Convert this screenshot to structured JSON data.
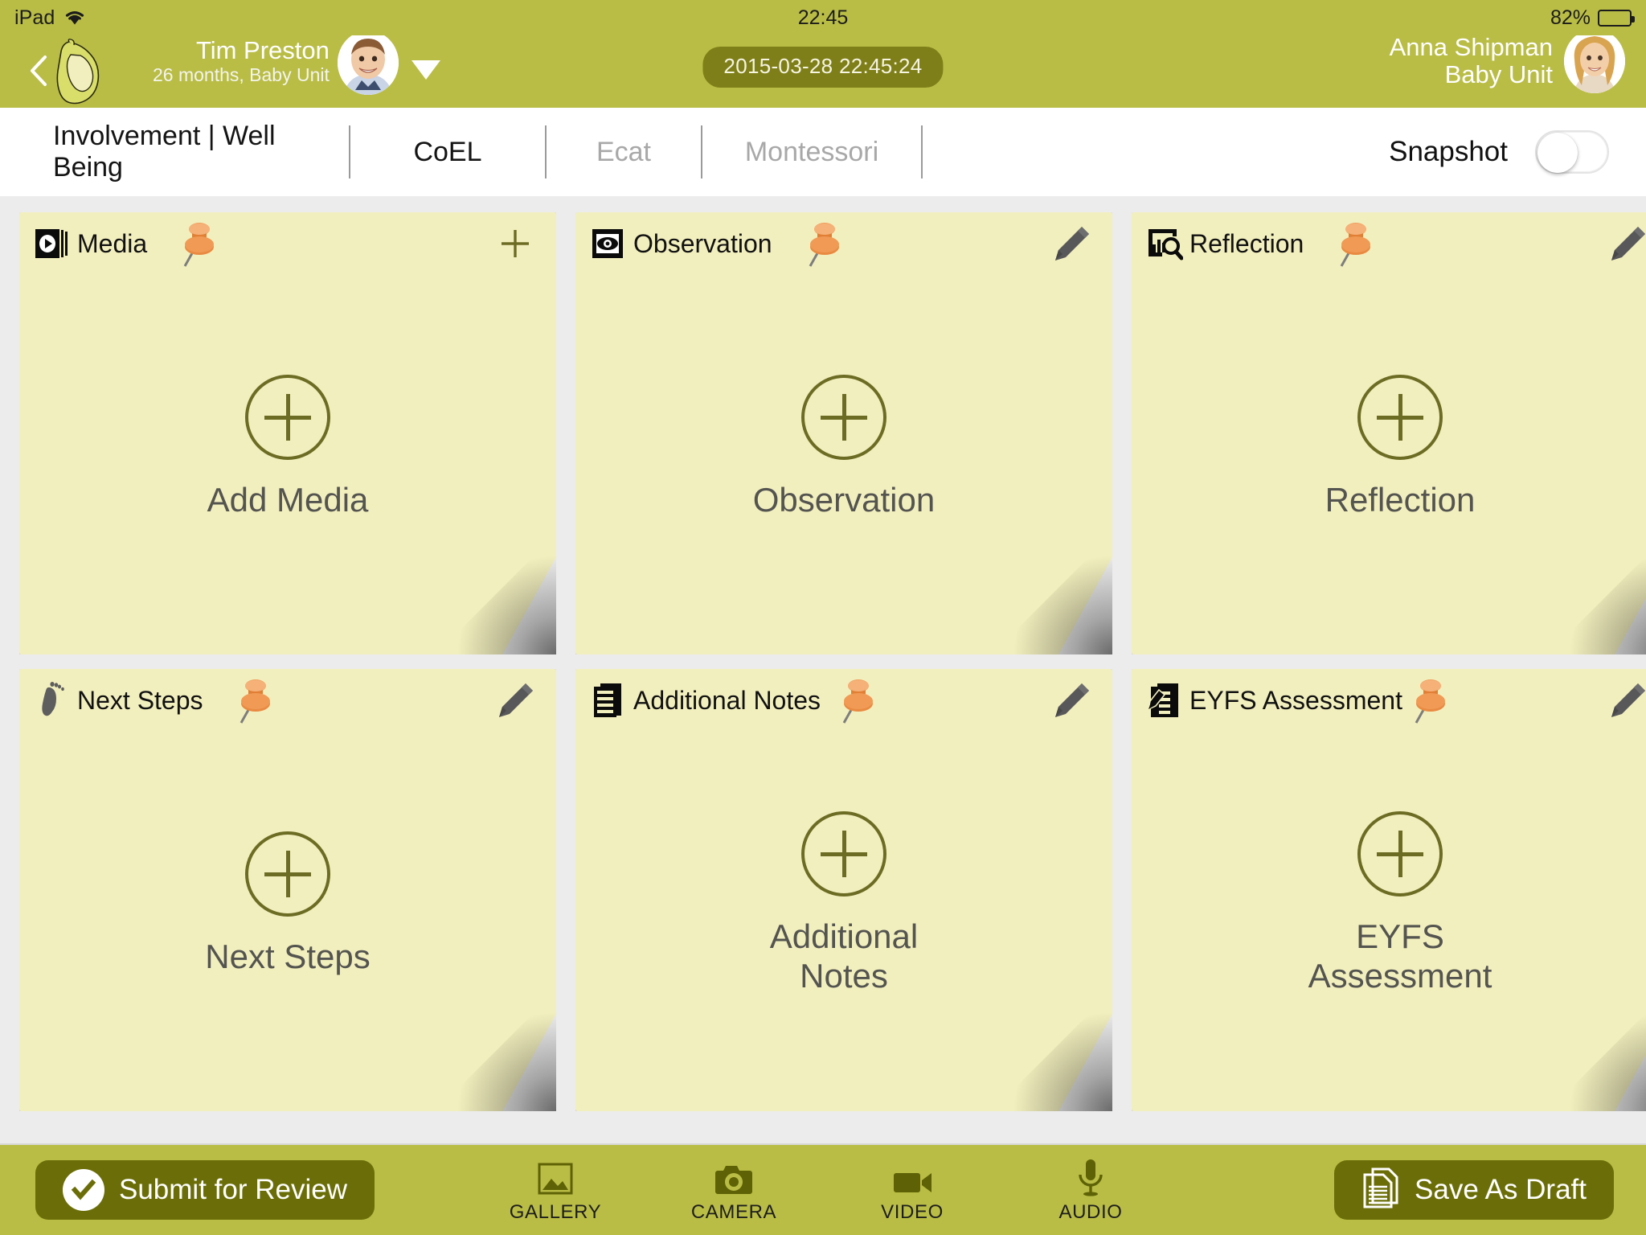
{
  "status_bar": {
    "device": "iPad",
    "wifi_icon": "wifi-icon",
    "time": "22:45",
    "battery_percent": "82%",
    "battery_level": 82
  },
  "nav": {
    "back_icon": "back-chevron-icon",
    "logo_icon": "elephant-logo-icon",
    "child": {
      "name": "Tim Preston",
      "details": "26 months, Baby Unit",
      "avatar_icon": "child-avatar",
      "caret_icon": "chevron-down-icon"
    },
    "timestamp": "2015-03-28 22:45:24",
    "staff": {
      "name": "Anna Shipman",
      "unit": "Baby Unit",
      "avatar_icon": "staff-avatar"
    }
  },
  "tabs": [
    {
      "label": "Involvement | Well Being",
      "active": true,
      "disabled": false
    },
    {
      "label": "CoEL",
      "active": true,
      "disabled": false
    },
    {
      "label": "Ecat",
      "active": false,
      "disabled": true
    },
    {
      "label": "Montessori",
      "active": false,
      "disabled": true
    }
  ],
  "snapshot": {
    "label": "Snapshot",
    "toggle_state": "off"
  },
  "cards": [
    {
      "title": "Media",
      "icon": "media-play-icon",
      "pin_icon": "pushpin-icon",
      "action_icon": "plus-icon",
      "body_label": "Add Media",
      "add_icon": "plus-circle-icon"
    },
    {
      "title": "Observation",
      "icon": "eye-icon",
      "pin_icon": "pushpin-icon",
      "action_icon": "pencil-icon",
      "body_label": "Observation",
      "add_icon": "plus-circle-icon"
    },
    {
      "title": "Reflection",
      "icon": "chart-search-icon",
      "pin_icon": "pushpin-icon",
      "action_icon": "pencil-icon",
      "body_label": "Reflection",
      "add_icon": "plus-circle-icon"
    },
    {
      "title": "Next Steps",
      "icon": "footprint-icon",
      "pin_icon": "pushpin-icon",
      "action_icon": "pencil-icon",
      "body_label": "Next Steps",
      "add_icon": "plus-circle-icon"
    },
    {
      "title": "Additional Notes",
      "icon": "notes-document-icon",
      "pin_icon": "pushpin-icon",
      "action_icon": "pencil-icon",
      "body_label": "Additional\nNotes",
      "add_icon": "plus-circle-icon"
    },
    {
      "title": "EYFS Assessment",
      "icon": "assessment-form-icon",
      "pin_icon": "pushpin-icon",
      "action_icon": "pencil-icon",
      "body_label": "EYFS\nAssessment",
      "add_icon": "plus-circle-icon"
    }
  ],
  "toolbar": {
    "submit_label": "Submit for Review",
    "submit_icon": "check-circle-icon",
    "save_label": "Save As Draft",
    "save_icon": "documents-icon",
    "media_tools": [
      {
        "label": "GALLERY",
        "icon": "gallery-icon"
      },
      {
        "label": "CAMERA",
        "icon": "camera-icon"
      },
      {
        "label": "VIDEO",
        "icon": "video-icon"
      },
      {
        "label": "AUDIO",
        "icon": "microphone-icon"
      }
    ]
  },
  "colors": {
    "brand_green": "#b9bd45",
    "dark_olive": "#6b6e08",
    "note_yellow": "#f2efbe",
    "page_grey": "#ececec",
    "pin_orange": "#e1853c"
  }
}
